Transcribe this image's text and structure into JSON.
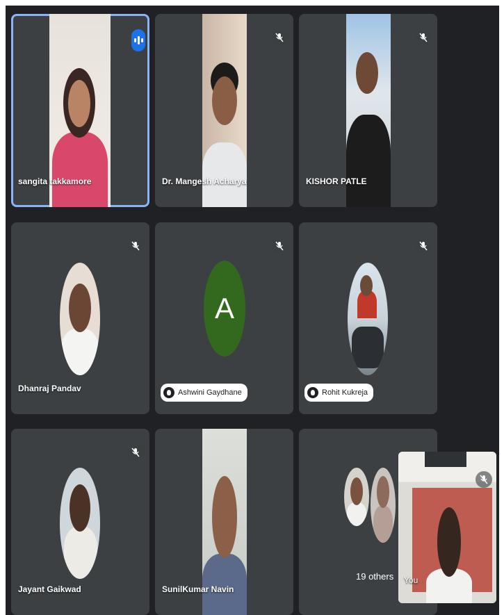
{
  "participants": [
    {
      "name": "sangita takkamore",
      "speaking": true
    },
    {
      "name": "Dr. Mangesh Acharya",
      "muted": true
    },
    {
      "name": "KISHOR PATLE",
      "muted": true
    },
    {
      "name": "Dhanraj Pandav",
      "muted": true
    },
    {
      "name": "Ashwini Gaydhane",
      "muted": true,
      "avatar_letter": "A",
      "avatar_color": "#33691e"
    },
    {
      "name": "Rohit Kukreja",
      "muted": true
    },
    {
      "name": "Jayant Gaikwad",
      "muted": true
    },
    {
      "name": "SunilKumar Navin"
    }
  ],
  "others": {
    "label": "19 others"
  },
  "self": {
    "label": "You",
    "muted": true
  },
  "colors": {
    "stage": "#202124",
    "tile": "#3c4043",
    "active_border": "#8ab4f8",
    "speaking_blue": "#1a73e8"
  }
}
